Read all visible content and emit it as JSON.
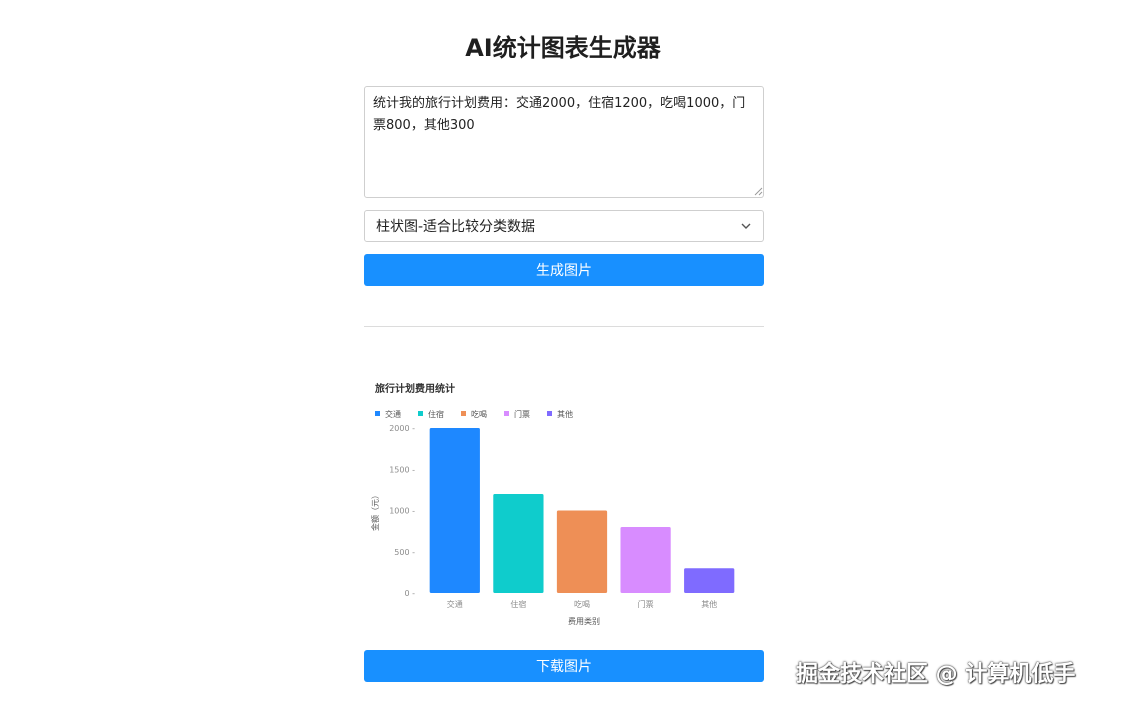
{
  "page": {
    "title": "AI统计图表生成器"
  },
  "prompt": {
    "value": "统计我的旅行计划费用：交通2000，住宿1200，吃喝1000，门票800，其他300"
  },
  "chart_type_select": {
    "selected": "柱状图-适合比较分类数据"
  },
  "buttons": {
    "generate": "生成图片",
    "download": "下载图片"
  },
  "icons": {
    "select_chevron": "chevron-down-icon",
    "resize": "resize-grip-icon"
  },
  "watermark": "掘金技术社区 @ 计算机低手",
  "colors": {
    "primary_button": "#1890ff",
    "series": [
      "#1e88ff",
      "#0fcccc",
      "#ee8f56",
      "#d88cff",
      "#7f6bff"
    ]
  },
  "chart_data": {
    "type": "bar",
    "title": "旅行计划费用统计",
    "categories": [
      "交通",
      "住宿",
      "吃喝",
      "门票",
      "其他"
    ],
    "values": [
      2000,
      1200,
      1000,
      800,
      300
    ],
    "legend": [
      "交通",
      "住宿",
      "吃喝",
      "门票",
      "其他"
    ],
    "legend_position": "top-left",
    "xlabel": "费用类别",
    "ylabel": "金额（元）",
    "ylim": [
      0,
      2000
    ],
    "yticks": [
      0,
      500,
      1000,
      1500,
      2000
    ],
    "grid": false
  }
}
